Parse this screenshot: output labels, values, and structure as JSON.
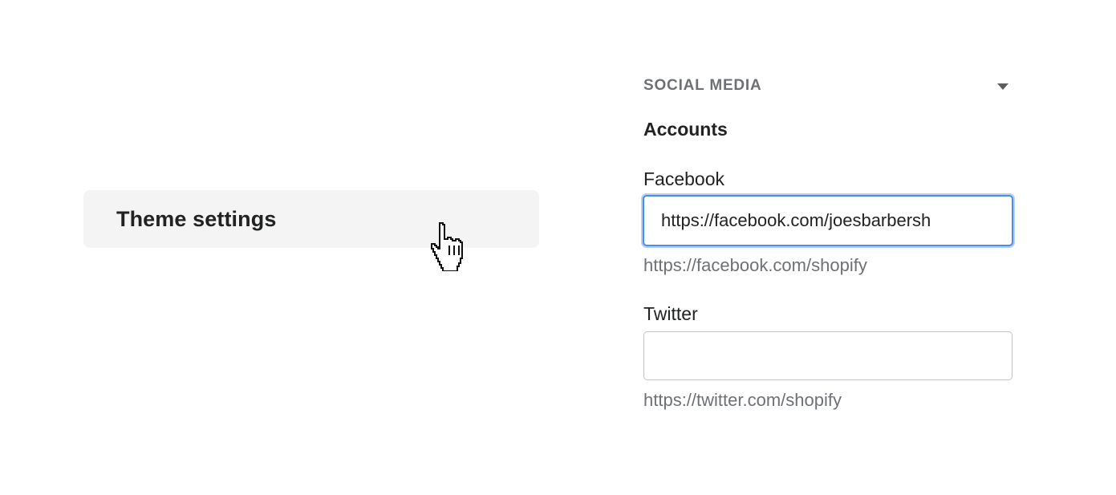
{
  "theme_menu": {
    "label": "Theme settings"
  },
  "cursor": {
    "icon": "pointer-hand-icon"
  },
  "social_media": {
    "section_title": "SOCIAL MEDIA",
    "collapse_icon": "caret-down-icon",
    "accounts_heading": "Accounts",
    "facebook": {
      "label": "Facebook",
      "value": "https://facebook.com/joesbarbersh",
      "placeholder": "",
      "help": "https://facebook.com/shopify",
      "focused": true
    },
    "twitter": {
      "label": "Twitter",
      "value": "",
      "placeholder": "",
      "help": "https://twitter.com/shopify",
      "focused": false
    }
  },
  "colors": {
    "focus_ring": "#4a8df0",
    "menu_item_bg": "#f4f4f4",
    "muted_text": "#6d7175",
    "primary_text": "#202223"
  }
}
